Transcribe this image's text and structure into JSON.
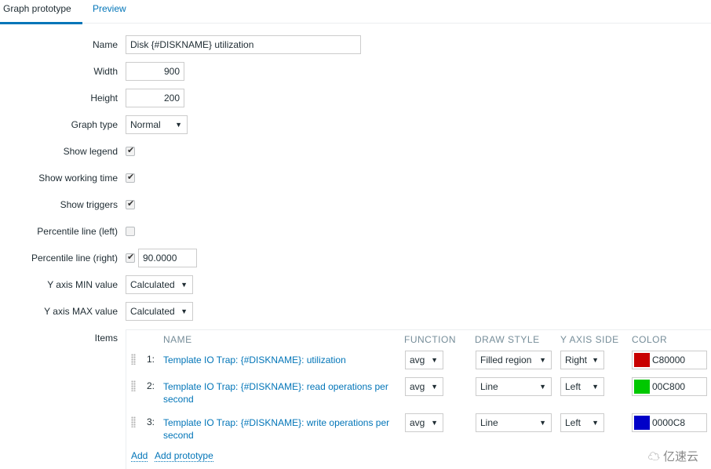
{
  "tabs": [
    {
      "label": "Graph prototype",
      "active": true
    },
    {
      "label": "Preview",
      "active": false
    }
  ],
  "form": {
    "name": {
      "label": "Name",
      "value": "Disk {#DISKNAME} utilization"
    },
    "width": {
      "label": "Width",
      "value": "900"
    },
    "height": {
      "label": "Height",
      "value": "200"
    },
    "graph_type": {
      "label": "Graph type",
      "value": "Normal"
    },
    "show_legend": {
      "label": "Show legend",
      "checked": true
    },
    "show_working_time": {
      "label": "Show working time",
      "checked": true
    },
    "show_triggers": {
      "label": "Show triggers",
      "checked": true
    },
    "percentile_left": {
      "label": "Percentile line (left)",
      "checked": false
    },
    "percentile_right": {
      "label": "Percentile line (right)",
      "checked": true,
      "value": "90.0000"
    },
    "y_min": {
      "label": "Y axis MIN value",
      "value": "Calculated"
    },
    "y_max": {
      "label": "Y axis MAX value",
      "value": "Calculated"
    }
  },
  "items": {
    "label": "Items",
    "headers": {
      "name": "NAME",
      "function": "FUNCTION",
      "draw_style": "DRAW STYLE",
      "y_axis_side": "Y AXIS SIDE",
      "color": "COLOR"
    },
    "rows": [
      {
        "index": "1:",
        "name": "Template IO Trap: {#DISKNAME}: utilization",
        "function": "avg",
        "draw_style": "Filled region",
        "y_axis_side": "Right",
        "color": "C80000",
        "color_hex": "#C80000"
      },
      {
        "index": "2:",
        "name": "Template IO Trap: {#DISKNAME}: read operations per second",
        "function": "avg",
        "draw_style": "Line",
        "y_axis_side": "Left",
        "color": "00C800",
        "color_hex": "#00C800"
      },
      {
        "index": "3:",
        "name": "Template IO Trap: {#DISKNAME}: write operations per second",
        "function": "avg",
        "draw_style": "Line",
        "y_axis_side": "Left",
        "color": "0000C8",
        "color_hex": "#0000C8"
      }
    ],
    "add_label": "Add",
    "add_prototype_label": "Add prototype"
  },
  "watermark": "亿速云",
  "icons": {
    "dropdown": "▼",
    "check": "✔",
    "logo": "☁"
  }
}
